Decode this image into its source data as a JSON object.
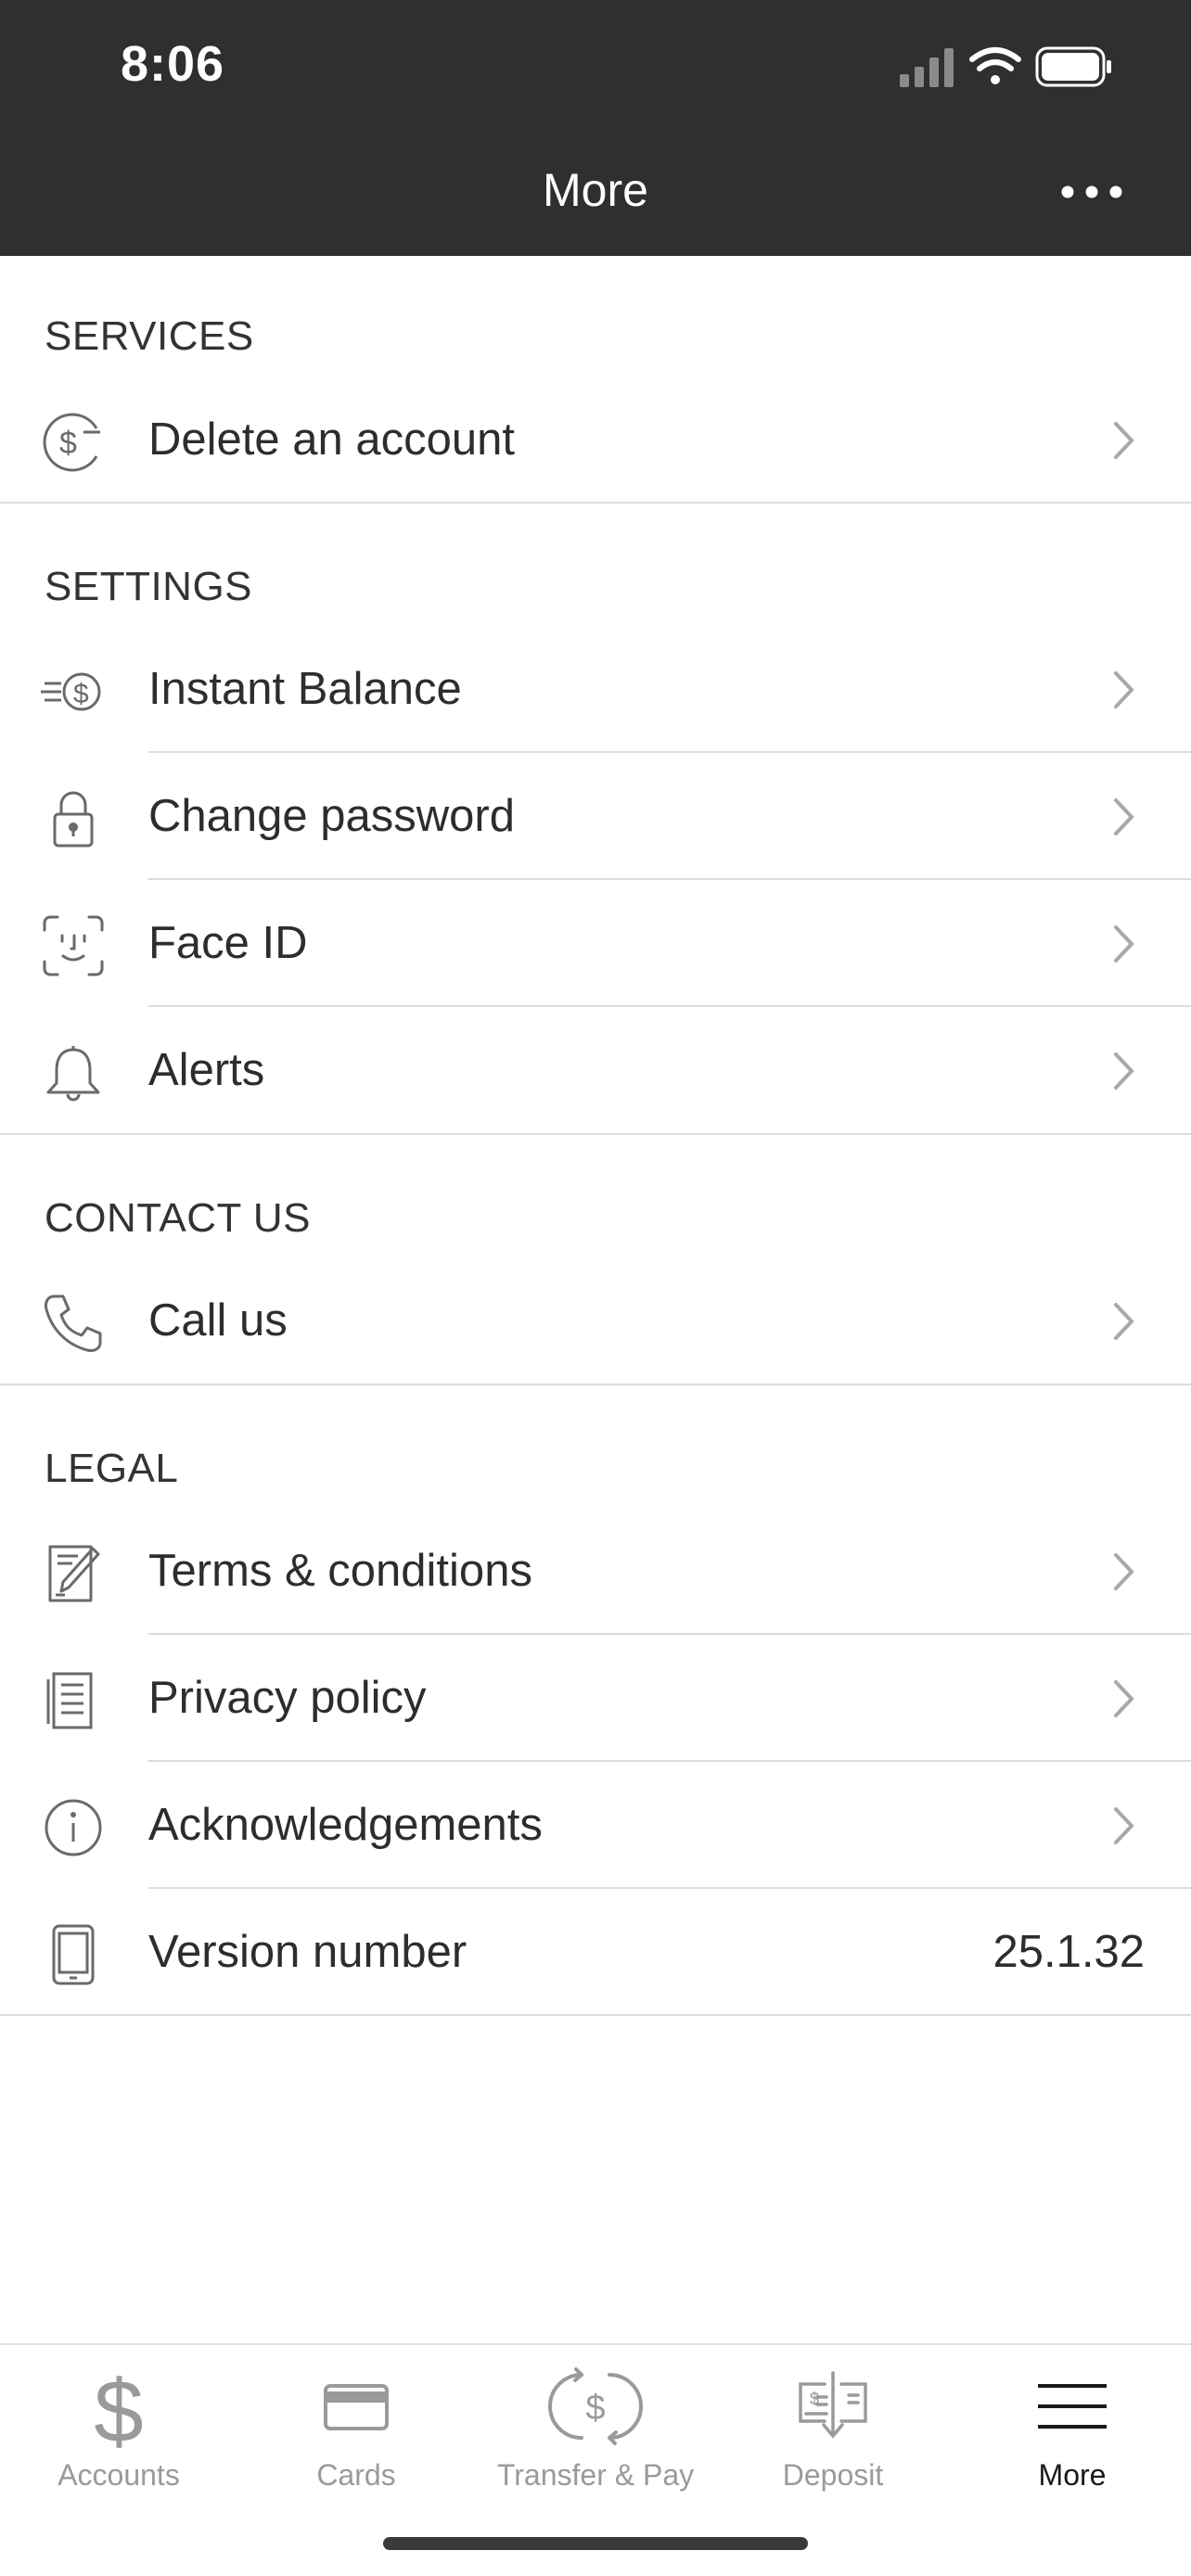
{
  "status_bar": {
    "time": "8:06"
  },
  "nav": {
    "title": "More"
  },
  "sections": {
    "services": {
      "header": "SERVICES",
      "items": [
        {
          "label": "Delete an account",
          "icon": "dollar-minus-icon"
        }
      ]
    },
    "settings": {
      "header": "SETTINGS",
      "items": [
        {
          "label": "Instant Balance",
          "icon": "instant-balance-icon"
        },
        {
          "label": "Change password",
          "icon": "lock-icon"
        },
        {
          "label": "Face ID",
          "icon": "face-id-icon"
        },
        {
          "label": "Alerts",
          "icon": "bell-icon"
        }
      ]
    },
    "contact": {
      "header": "CONTACT US",
      "items": [
        {
          "label": "Call us",
          "icon": "phone-icon"
        }
      ]
    },
    "legal": {
      "header": "LEGAL",
      "items": [
        {
          "label": "Terms & conditions",
          "icon": "document-pencil-icon"
        },
        {
          "label": "Privacy policy",
          "icon": "document-icon"
        },
        {
          "label": "Acknowledgements",
          "icon": "info-icon"
        },
        {
          "label": "Version number",
          "icon": "phone-device-icon",
          "value": "25.1.32"
        }
      ]
    }
  },
  "tabbar": {
    "tabs": [
      {
        "label": "Accounts",
        "icon": "dollar-icon"
      },
      {
        "label": "Cards",
        "icon": "card-icon"
      },
      {
        "label": "Transfer & Pay",
        "icon": "transfer-icon"
      },
      {
        "label": "Deposit",
        "icon": "check-deposit-icon"
      },
      {
        "label": "More",
        "icon": "hamburger-icon",
        "active": true
      }
    ]
  },
  "colors": {
    "nav_bg": "#2f2f2f",
    "divider": "#dcdcdc",
    "icon_gray": "#6a6a6a",
    "inactive_tab": "#9a9a9a"
  }
}
